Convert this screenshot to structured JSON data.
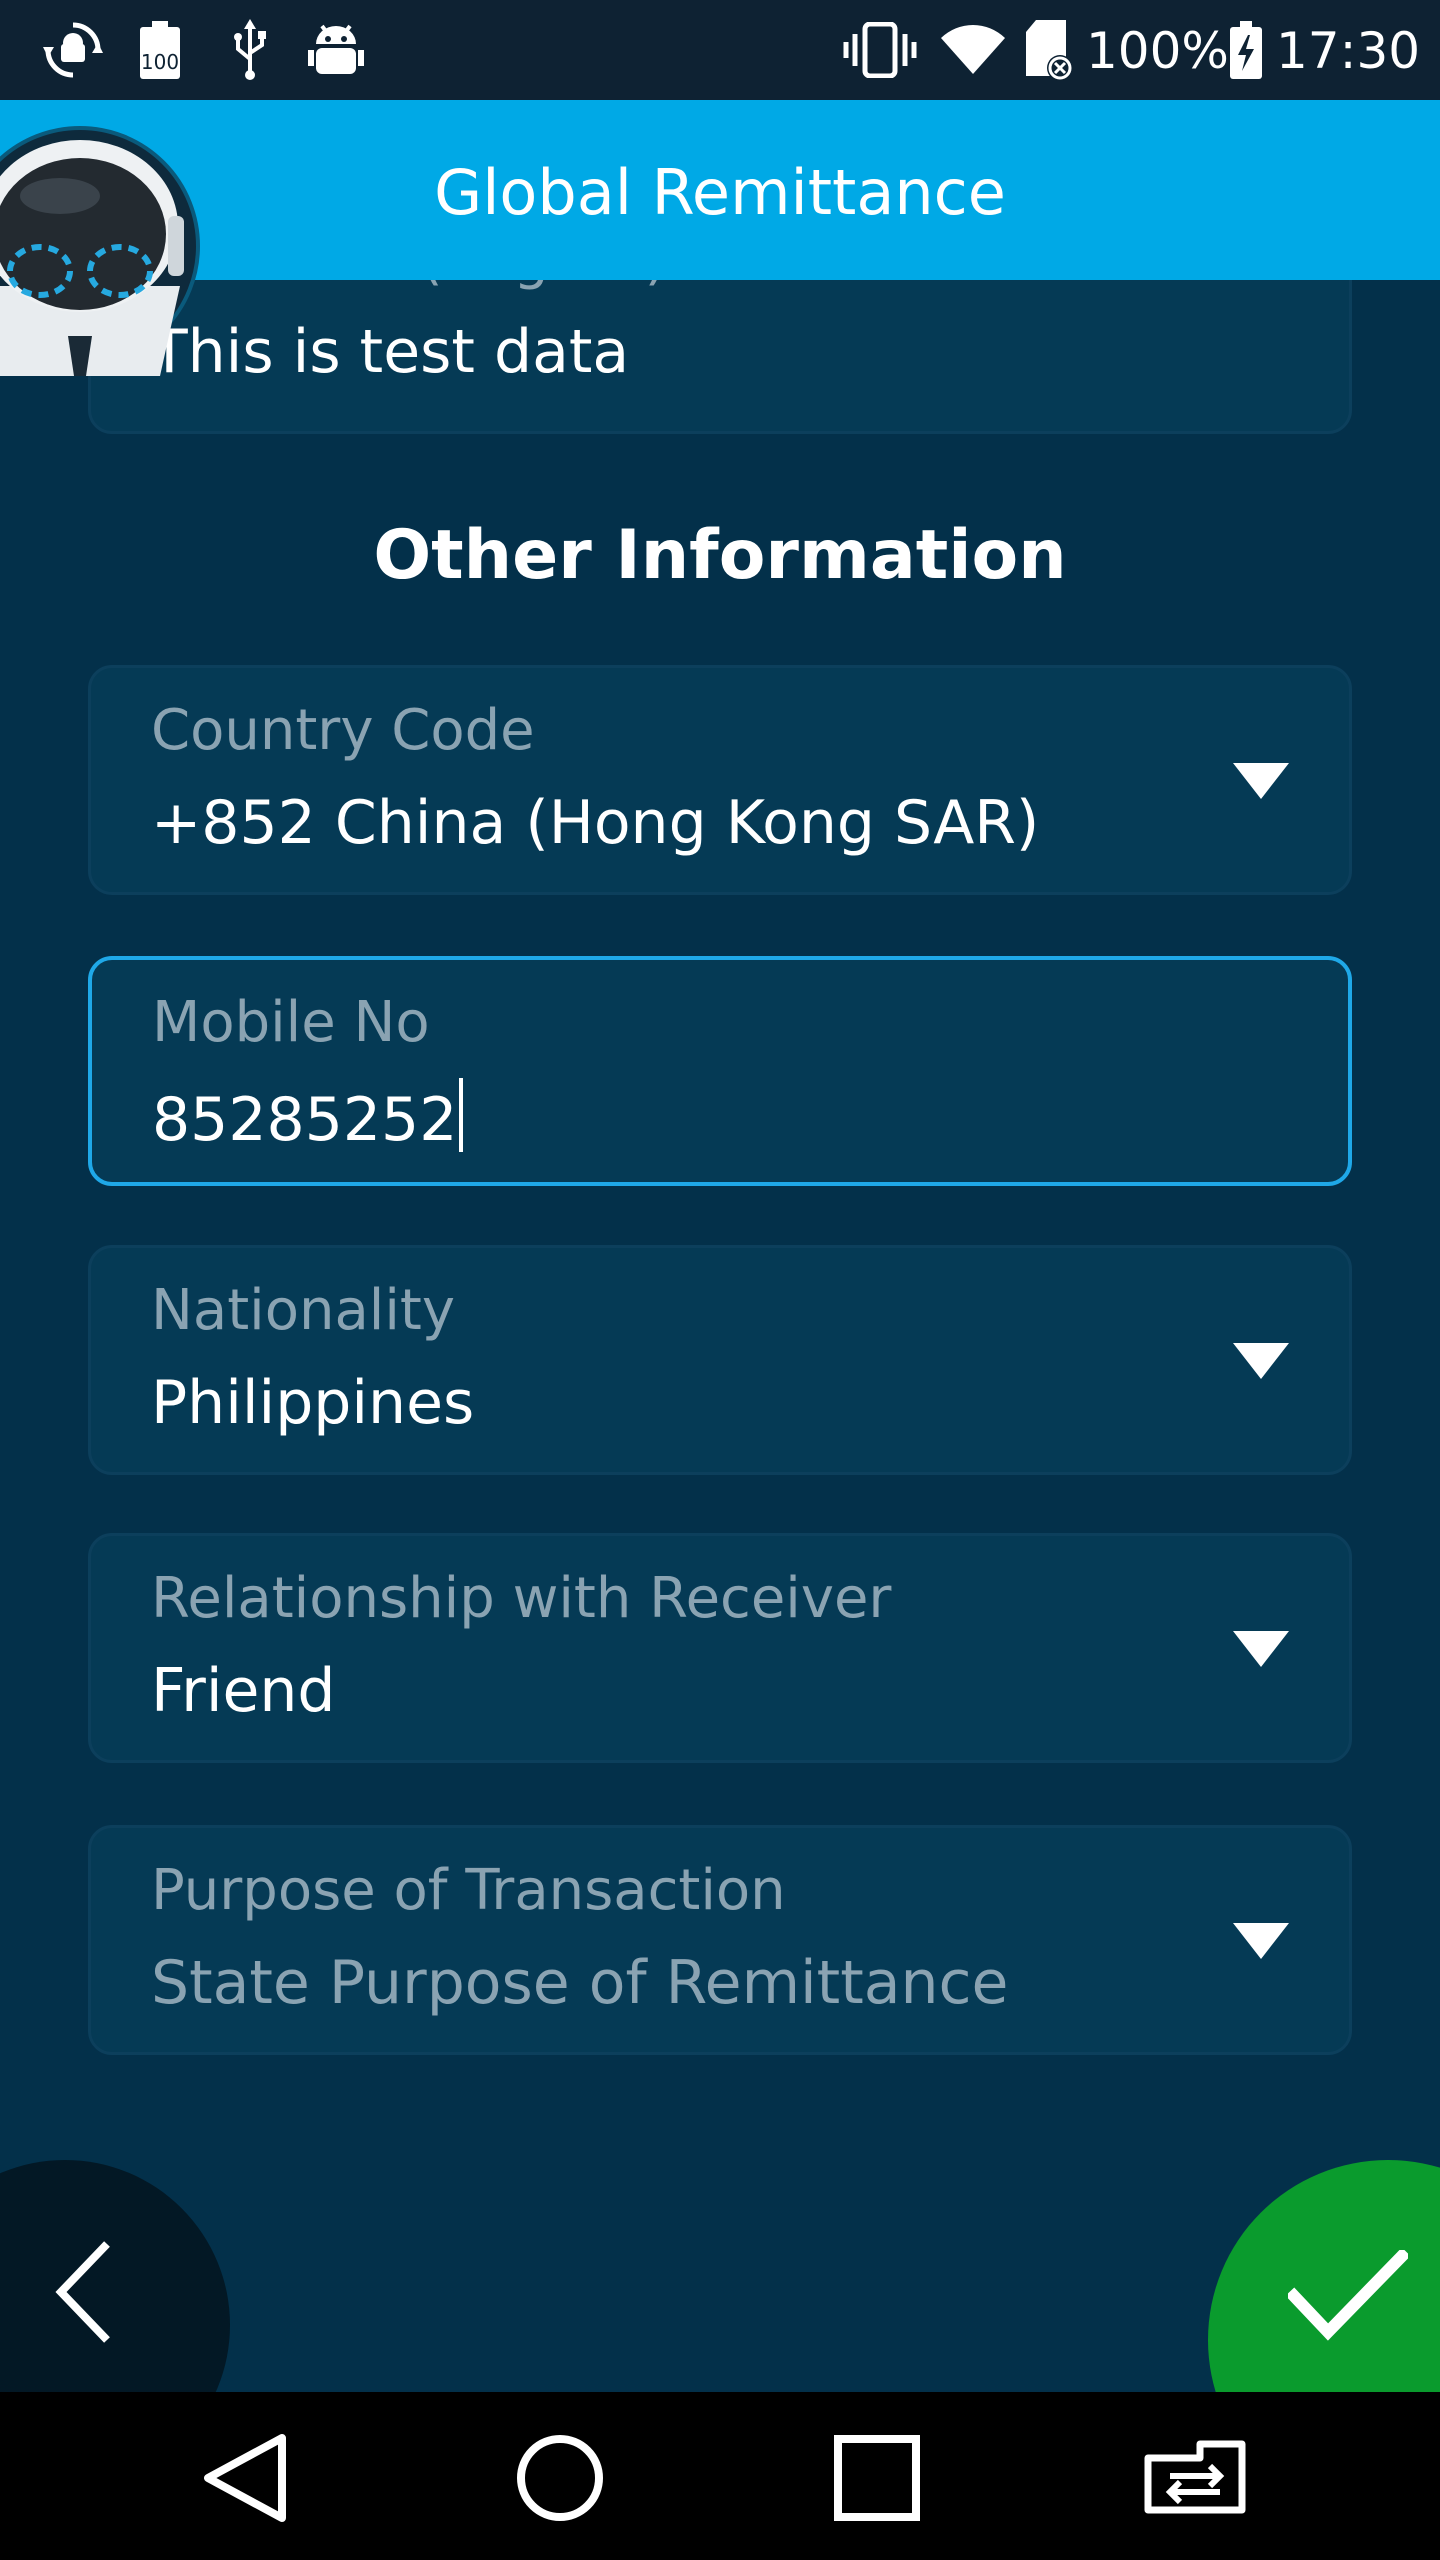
{
  "status_bar": {
    "battery_percent": "100%",
    "time": "17:30",
    "icons_left": [
      "sync-android-icon",
      "battery-100-icon",
      "usb-icon",
      "android-debug-icon"
    ],
    "icons_right": [
      "vibrate-icon",
      "wifi-icon",
      "sd-card-error-icon",
      "battery-charging-icon"
    ]
  },
  "app_bar": {
    "title": "Global Remittance"
  },
  "form": {
    "surname": {
      "label": "Surname (English)",
      "value": "This is test data"
    },
    "section_title": "Other Information",
    "country_code": {
      "label": "Country Code",
      "value": "+852 China (Hong Kong SAR)"
    },
    "mobile_no": {
      "label": "Mobile No",
      "value": "85285252"
    },
    "nationality": {
      "label": "Nationality",
      "value": "Philippines"
    },
    "relationship": {
      "label": "Relationship with Receiver",
      "value": "Friend"
    },
    "purpose": {
      "label": "Purpose of Transaction",
      "placeholder": "State Purpose of Remittance"
    }
  },
  "colors": {
    "app_bar": "#00a9e6",
    "background": "#03304a",
    "field_background": "#053a55",
    "focus_border": "#1fa8e8",
    "confirm_button": "#0a9b2d",
    "label_text": "#8aa3b2"
  },
  "navigation": {
    "items": [
      "back-icon",
      "home-icon",
      "recents-icon",
      "switch-app-icon"
    ]
  }
}
